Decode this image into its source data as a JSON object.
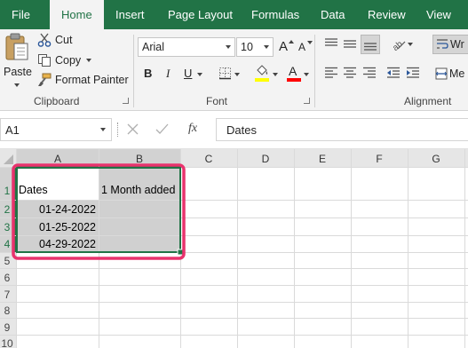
{
  "menu": {
    "tabs": [
      {
        "label": "File"
      },
      {
        "label": "Home"
      },
      {
        "label": "Insert"
      },
      {
        "label": "Page Layout"
      },
      {
        "label": "Formulas"
      },
      {
        "label": "Data"
      },
      {
        "label": "Review"
      },
      {
        "label": "View"
      }
    ],
    "active_tab": "Home",
    "bar_color": "#217346"
  },
  "ribbon": {
    "clipboard": {
      "paste_label": "Paste",
      "cut_label": "Cut",
      "copy_label": "Copy",
      "format_painter_label": "Format Painter",
      "group_label": "Clipboard"
    },
    "font": {
      "font_name": "Arial",
      "font_size": "10",
      "grow_label": "A",
      "shrink_label": "A",
      "bold": "B",
      "italic": "I",
      "underline": "U",
      "font_color_letter": "A",
      "group_label": "Font",
      "fill_color": "#ffff00",
      "font_color": "#ff0000"
    },
    "alignment": {
      "wrap_label": "Wr",
      "merge_label": "Me",
      "group_label": "Alignment"
    }
  },
  "formula_bar": {
    "name_box": "A1",
    "fx_label": "fx",
    "value": "Dates"
  },
  "sheet": {
    "columns": [
      "A",
      "B",
      "C",
      "D",
      "E",
      "F",
      "G"
    ],
    "rows": [
      "1",
      "2",
      "3",
      "4",
      "5",
      "6",
      "7",
      "8",
      "9",
      "10"
    ],
    "cells": {
      "A1": "Dates",
      "B1": "1 Month added",
      "A2": "01-24-2022",
      "A3": "01-25-2022",
      "A4": "04-29-2022"
    },
    "selection_range": "A1:B4",
    "highlight_color": "#e8336d",
    "selection_fill": "#d0d0d0"
  }
}
